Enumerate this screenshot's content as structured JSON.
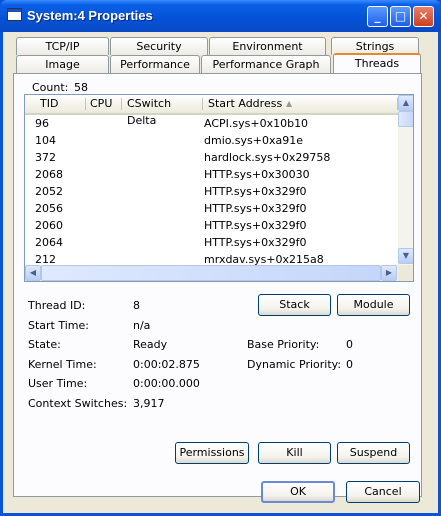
{
  "window": {
    "title": "System:4 Properties",
    "controls": {
      "minimize": "_",
      "maximize": "□",
      "close": "✕"
    }
  },
  "tabs": {
    "row1": [
      "TCP/IP",
      "Security",
      "Environment",
      "Strings"
    ],
    "row2": [
      "Image",
      "Performance",
      "Performance Graph",
      "Threads"
    ],
    "active": "Threads"
  },
  "threads": {
    "count_label": "Count:",
    "count": "58",
    "columns": [
      "TID",
      "CPU",
      "CSwitch Delta",
      "Start Address"
    ],
    "sort_indicator": "▲",
    "rows": [
      {
        "tid": "96",
        "address": "ACPI.sys+0x10b10"
      },
      {
        "tid": "104",
        "address": "dmio.sys+0xa91e"
      },
      {
        "tid": "372",
        "address": "hardlock.sys+0x29758"
      },
      {
        "tid": "2068",
        "address": "HTTP.sys+0x30030"
      },
      {
        "tid": "2052",
        "address": "HTTP.sys+0x329f0"
      },
      {
        "tid": "2056",
        "address": "HTTP.sys+0x329f0"
      },
      {
        "tid": "2060",
        "address": "HTTP.sys+0x329f0"
      },
      {
        "tid": "2064",
        "address": "HTTP.sys+0x329f0"
      },
      {
        "tid": "212",
        "address": "mrxdav.sys+0x215a8"
      }
    ],
    "selected_row": 0
  },
  "details": {
    "thread_id_label": "Thread ID:",
    "thread_id": "8",
    "start_time_label": "Start Time:",
    "start_time": "n/a",
    "state_label": "State:",
    "state": "Ready",
    "base_priority_label": "Base Priority:",
    "base_priority": "0",
    "kernel_time_label": "Kernel Time:",
    "kernel_time": "0:00:02.875",
    "dynamic_priority_label": "Dynamic Priority:",
    "dynamic_priority": "0",
    "user_time_label": "User Time:",
    "user_time": "0:00:00.000",
    "context_switches_label": "Context Switches:",
    "context_switches": "3,917"
  },
  "buttons": {
    "stack": "Stack",
    "module": "Module",
    "permissions": "Permissions",
    "kill": "Kill",
    "suspend": "Suspend",
    "ok": "OK",
    "cancel": "Cancel"
  },
  "scrollbar_glyphs": {
    "up": "▲",
    "down": "▼",
    "left": "◀",
    "right": "▶"
  },
  "colors": {
    "titlebar": "#0a5fe6",
    "dialog_bg": "#ece9d8",
    "tab_accent": "#e68b2c",
    "selection": "#316ac5"
  }
}
